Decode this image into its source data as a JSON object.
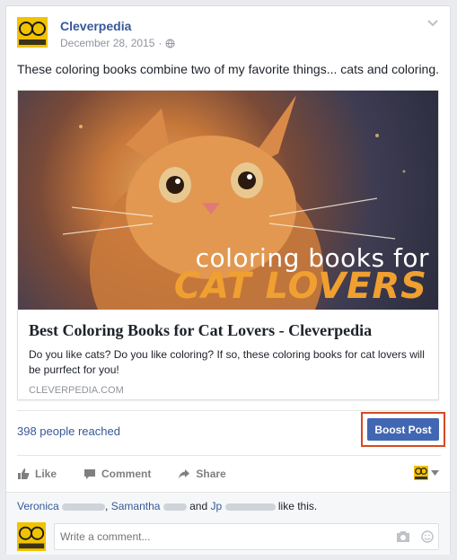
{
  "post": {
    "page_name": "Cleverpedia",
    "date": "December 28, 2015",
    "separator": "·",
    "text": "These coloring books combine two of my favorite things... cats and coloring."
  },
  "link": {
    "image_overlay_line1": "coloring books for",
    "image_overlay_line2": "CAT LOVERS",
    "title": "Best Coloring Books for Cat Lovers - Cleverpedia",
    "description": "Do you like cats? Do you like coloring? If so, these coloring books for cat lovers will be purrfect for you!",
    "domain": "CLEVERPEDIA.COM"
  },
  "stats": {
    "reached": "398 people reached",
    "boost_label": "Boost Post"
  },
  "actions": {
    "like": "Like",
    "comment": "Comment",
    "share": "Share"
  },
  "likes": {
    "name1": "Veronica",
    "sep1": ",",
    "name2": "Samantha",
    "and": "and",
    "name3": "Jp",
    "suffix": "like this."
  },
  "comment": {
    "placeholder": "Write a comment..."
  },
  "colors": {
    "brand_blue": "#365899",
    "button_blue": "#4267b2",
    "highlight": "#d64a21",
    "avatar_yellow": "#f2c200"
  }
}
